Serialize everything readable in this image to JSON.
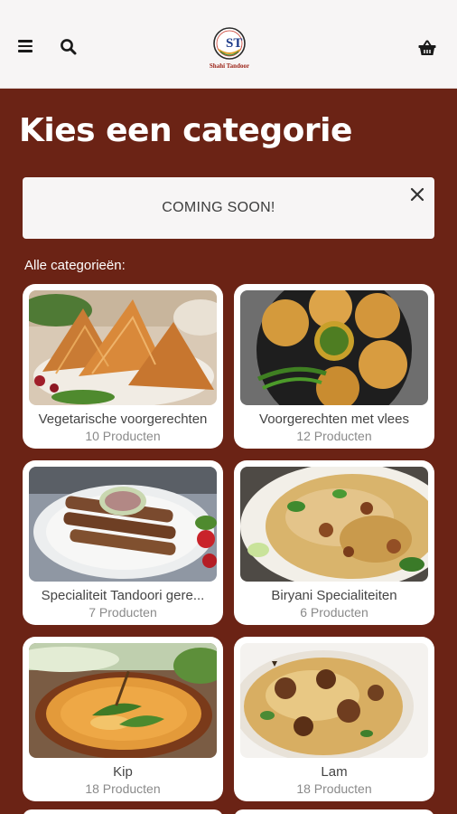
{
  "header": {
    "menu_icon": "hamburger-menu-icon",
    "search_icon": "search-icon",
    "logo_text": "Shahi Tandoor",
    "logo_monogram": "ST",
    "cart_icon": "basket-icon"
  },
  "page_title": "Kies een categorie",
  "notice": {
    "text": "COMING SOON!",
    "close_icon": "close-icon"
  },
  "section_label": "Alle categorieën:",
  "categories": [
    {
      "name": "Vegetarische voorgerechten",
      "count": "10 Producten"
    },
    {
      "name": "Voorgerechten met vlees",
      "count": "12 Producten"
    },
    {
      "name": "Specialiteit Tandoori gere...",
      "count": "7 Producten"
    },
    {
      "name": "Biryani Specialiteiten",
      "count": "6 Producten"
    },
    {
      "name": "Kip",
      "count": "18 Producten"
    },
    {
      "name": "Lam",
      "count": "18 Producten"
    }
  ],
  "colors": {
    "brand": "#6b2315",
    "header_bg": "#f7f5f5",
    "card_bg": "#ffffff"
  }
}
